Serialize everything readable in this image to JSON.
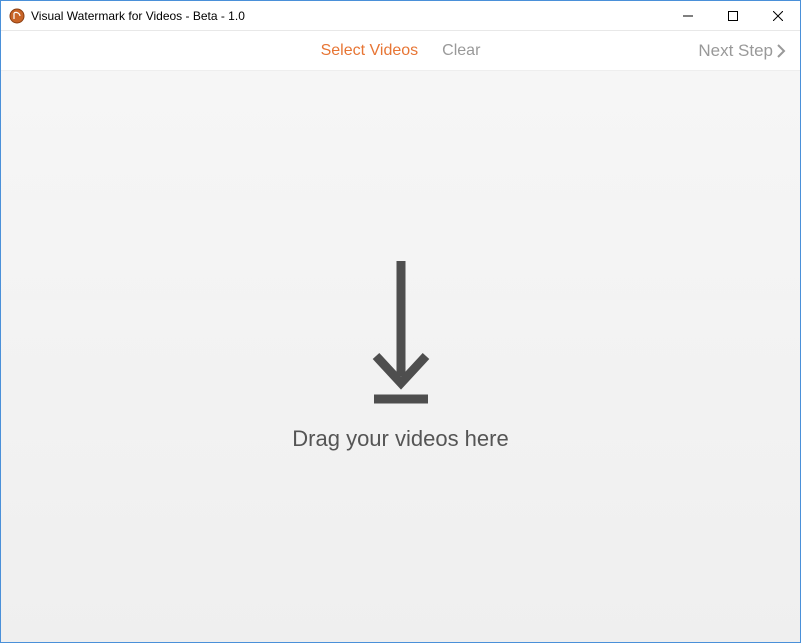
{
  "titlebar": {
    "title": "Visual Watermark for Videos - Beta - 1.0"
  },
  "toolbar": {
    "select_videos": "Select Videos",
    "clear": "Clear",
    "next_step": "Next Step"
  },
  "drop": {
    "prompt": "Drag your videos here"
  },
  "colors": {
    "accent": "#e77534",
    "muted": "#999999",
    "arrow": "#4e4e4e"
  }
}
